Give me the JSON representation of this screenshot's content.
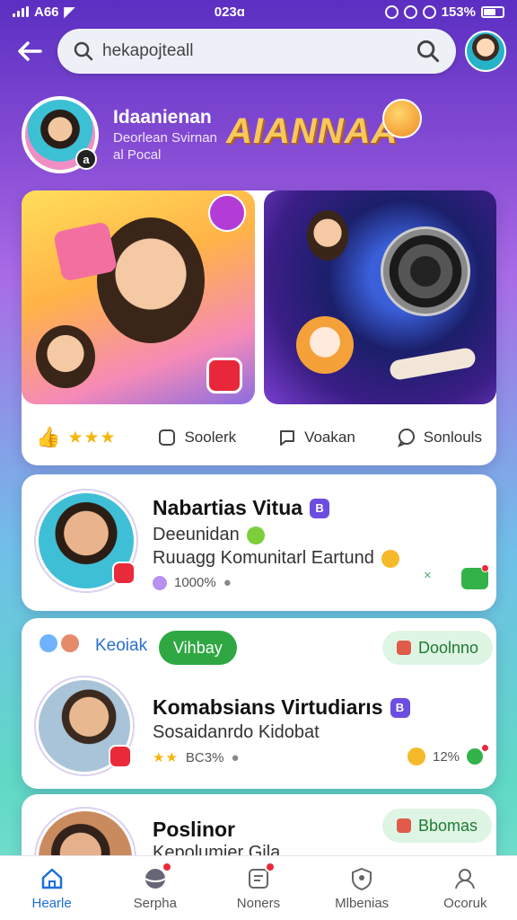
{
  "status_bar": {
    "carrier": "A66",
    "time": "023ɑ",
    "battery": "153%"
  },
  "search": {
    "value": "hekapojteall"
  },
  "profile": {
    "name": "Idaanienan",
    "line1": "Deorlean Svirnan",
    "line2": "al Pocal",
    "brand": "AIANNAA",
    "badge": "a"
  },
  "featured": {
    "actions": [
      {
        "label": "Soolerk"
      },
      {
        "label": "Voakan"
      },
      {
        "label": "Sonlouls"
      }
    ],
    "stars": "★★★"
  },
  "cards": [
    {
      "title": "Nabartias Vitua",
      "verify": "B",
      "subtitle": "Deeunidan",
      "description": "Ruuagg Komunitarl Eartund",
      "meta": "1000%",
      "side": "×"
    },
    {
      "tag": "Keoiak",
      "pill": "Vihbay",
      "pill_right": "Doolnno",
      "title": "Komabsians Virtudiarıs",
      "verify": "B",
      "subtitle": "Sosaidanrdo Kidobat",
      "meta": "BC3%",
      "stars": "★★",
      "right_meta": "12%"
    },
    {
      "title": "Poslinor",
      "subtitle": "Kepolumier Gila",
      "pill_right": "Bbomas"
    }
  ],
  "nav": [
    {
      "label": "Hearle",
      "icon": "home-icon"
    },
    {
      "label": "Serpha",
      "icon": "planet-icon"
    },
    {
      "label": "Noners",
      "icon": "notes-icon"
    },
    {
      "label": "Mlbenias",
      "icon": "shield-icon"
    },
    {
      "label": "Ocoruk",
      "icon": "user-icon"
    }
  ],
  "colors": {
    "accent": "#1d6fd8",
    "brand": "#f7c85a",
    "green": "#2fa843",
    "purple": "#6b4ee0"
  }
}
